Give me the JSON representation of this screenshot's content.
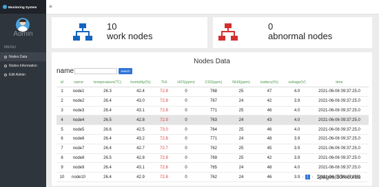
{
  "brand": {
    "title": "Monitoring System"
  },
  "user": {
    "name": "Admin"
  },
  "menu": {
    "title": "MENU",
    "items": [
      {
        "label": "Nodes Data",
        "active": true
      },
      {
        "label": "Nodes Information",
        "active": false
      },
      {
        "label": "Edit Admin",
        "active": false
      }
    ]
  },
  "cards": {
    "work": {
      "count": "10",
      "label": "work nodes",
      "color": "#1565c0",
      "icon": "network-icon"
    },
    "abnormal": {
      "count": "0",
      "label": "abnormal nodes",
      "color": "#d32f2f",
      "icon": "network-icon"
    }
  },
  "panel": {
    "title": "Nodes Data",
    "search_label": "name",
    "search_value": "",
    "search_button": "search"
  },
  "table": {
    "columns": [
      "id",
      "name",
      "temperature(℃)",
      "humidity(%)",
      "THI",
      "H2S(ppm)",
      "C02(ppm)",
      "NH3(ppm)",
      "battery(%)",
      "voltage(V)",
      "time"
    ],
    "rows": [
      [
        "1",
        "node1",
        "26.3",
        "42.4",
        "72.8",
        "0",
        "768",
        "25",
        "47",
        "4.0",
        "2021-06-06 09:37:25.0"
      ],
      [
        "2",
        "node2",
        "26.4",
        "43.0",
        "72.8",
        "0",
        "767",
        "24",
        "42",
        "3.9",
        "2021-06-06 09:37:25.0"
      ],
      [
        "3",
        "node3",
        "26.4",
        "43.1",
        "72.8",
        "0",
        "771",
        "25",
        "46",
        "4.0",
        "2021-06-06 09:37:25.0"
      ],
      [
        "4",
        "node4",
        "26.5",
        "42.8",
        "72.9",
        "0",
        "763",
        "24",
        "43",
        "4.0",
        "2021-06-06 09:37:25.0"
      ],
      [
        "5",
        "node5",
        "26.6",
        "42.5",
        "73.0",
        "0",
        "764",
        "25",
        "46",
        "4.0",
        "2021-06-06 09:37:25.0"
      ],
      [
        "6",
        "node6",
        "26.4",
        "43.2",
        "72.8",
        "0",
        "771",
        "24",
        "48",
        "3.9",
        "2021-06-06 09:37:25.0"
      ],
      [
        "7",
        "node7",
        "26.4",
        "42.7",
        "72.7",
        "0",
        "762",
        "25",
        "45",
        "3.9",
        "2021-06-06 09:37:25.0"
      ],
      [
        "8",
        "node8",
        "26.5",
        "42.8",
        "72.9",
        "0",
        "769",
        "25",
        "42",
        "3.9",
        "2021-06-06 09:37:25.0"
      ],
      [
        "9",
        "node9",
        "26.4",
        "43.1",
        "72.8",
        "0",
        "765",
        "24",
        "48",
        "4.0",
        "2021-06-06 09:37:25.0"
      ],
      [
        "10",
        "node10",
        "26.4",
        "42.9",
        "72.8",
        "0",
        "762",
        "24",
        "46",
        "3.9",
        "2021-06-06 09:37:25.0"
      ]
    ],
    "highlighted_row": 3
  },
  "pager": {
    "prev": "‹",
    "current_page": "1",
    "next": "›",
    "info": "1pages,10records"
  }
}
